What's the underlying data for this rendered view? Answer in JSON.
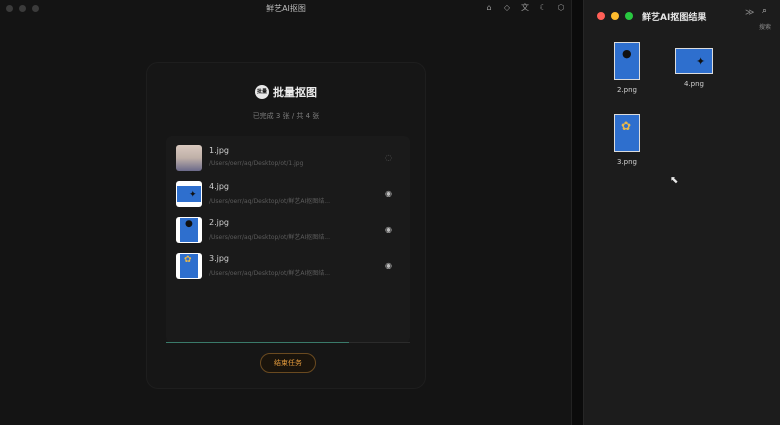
{
  "app": {
    "title": "鲜艺AI抠图",
    "toolbar_icons": [
      "home-icon",
      "tag-icon",
      "translate-icon",
      "moon-icon",
      "cube-icon"
    ],
    "brand_logo_text": "批量",
    "brand_name": "批量抠图",
    "progress_text": "已完成 3 张 / 共 4 张",
    "progress_fraction": 0.75,
    "files": [
      {
        "name": "1.jpg",
        "path": "/Users/oerr/aq/Desktop/ot/1.jpg",
        "thumb": "person",
        "status": "processing"
      },
      {
        "name": "4.jpg",
        "path": "/Users/oerr/aq/Desktop/ot/鲜艺AI抠图结...",
        "thumb": "bird",
        "status": "done"
      },
      {
        "name": "2.jpg",
        "path": "/Users/oerr/aq/Desktop/ot/鲜艺AI抠图结...",
        "thumb": "cup",
        "status": "done"
      },
      {
        "name": "3.jpg",
        "path": "/Users/oerr/aq/Desktop/ot/鲜艺AI抠图结...",
        "thumb": "flower",
        "status": "done"
      }
    ],
    "end_button_label": "结束任务"
  },
  "finder": {
    "title": "鲜艺AI抠图结果",
    "more_icon": "chevrons-right-icon",
    "search_label": "搜索",
    "traffic_colors": [
      "#ff5f57",
      "#febc2e",
      "#28c840"
    ],
    "files": [
      {
        "name": "2.png",
        "thumb": "cup"
      },
      {
        "name": "4.png",
        "thumb": "bird"
      },
      {
        "name": "3.png",
        "thumb": "flower"
      }
    ]
  },
  "colors": {
    "accent_orange": "#e39a3c",
    "image_blue": "#2e6fce",
    "progress_green": "#3a7a6a"
  }
}
